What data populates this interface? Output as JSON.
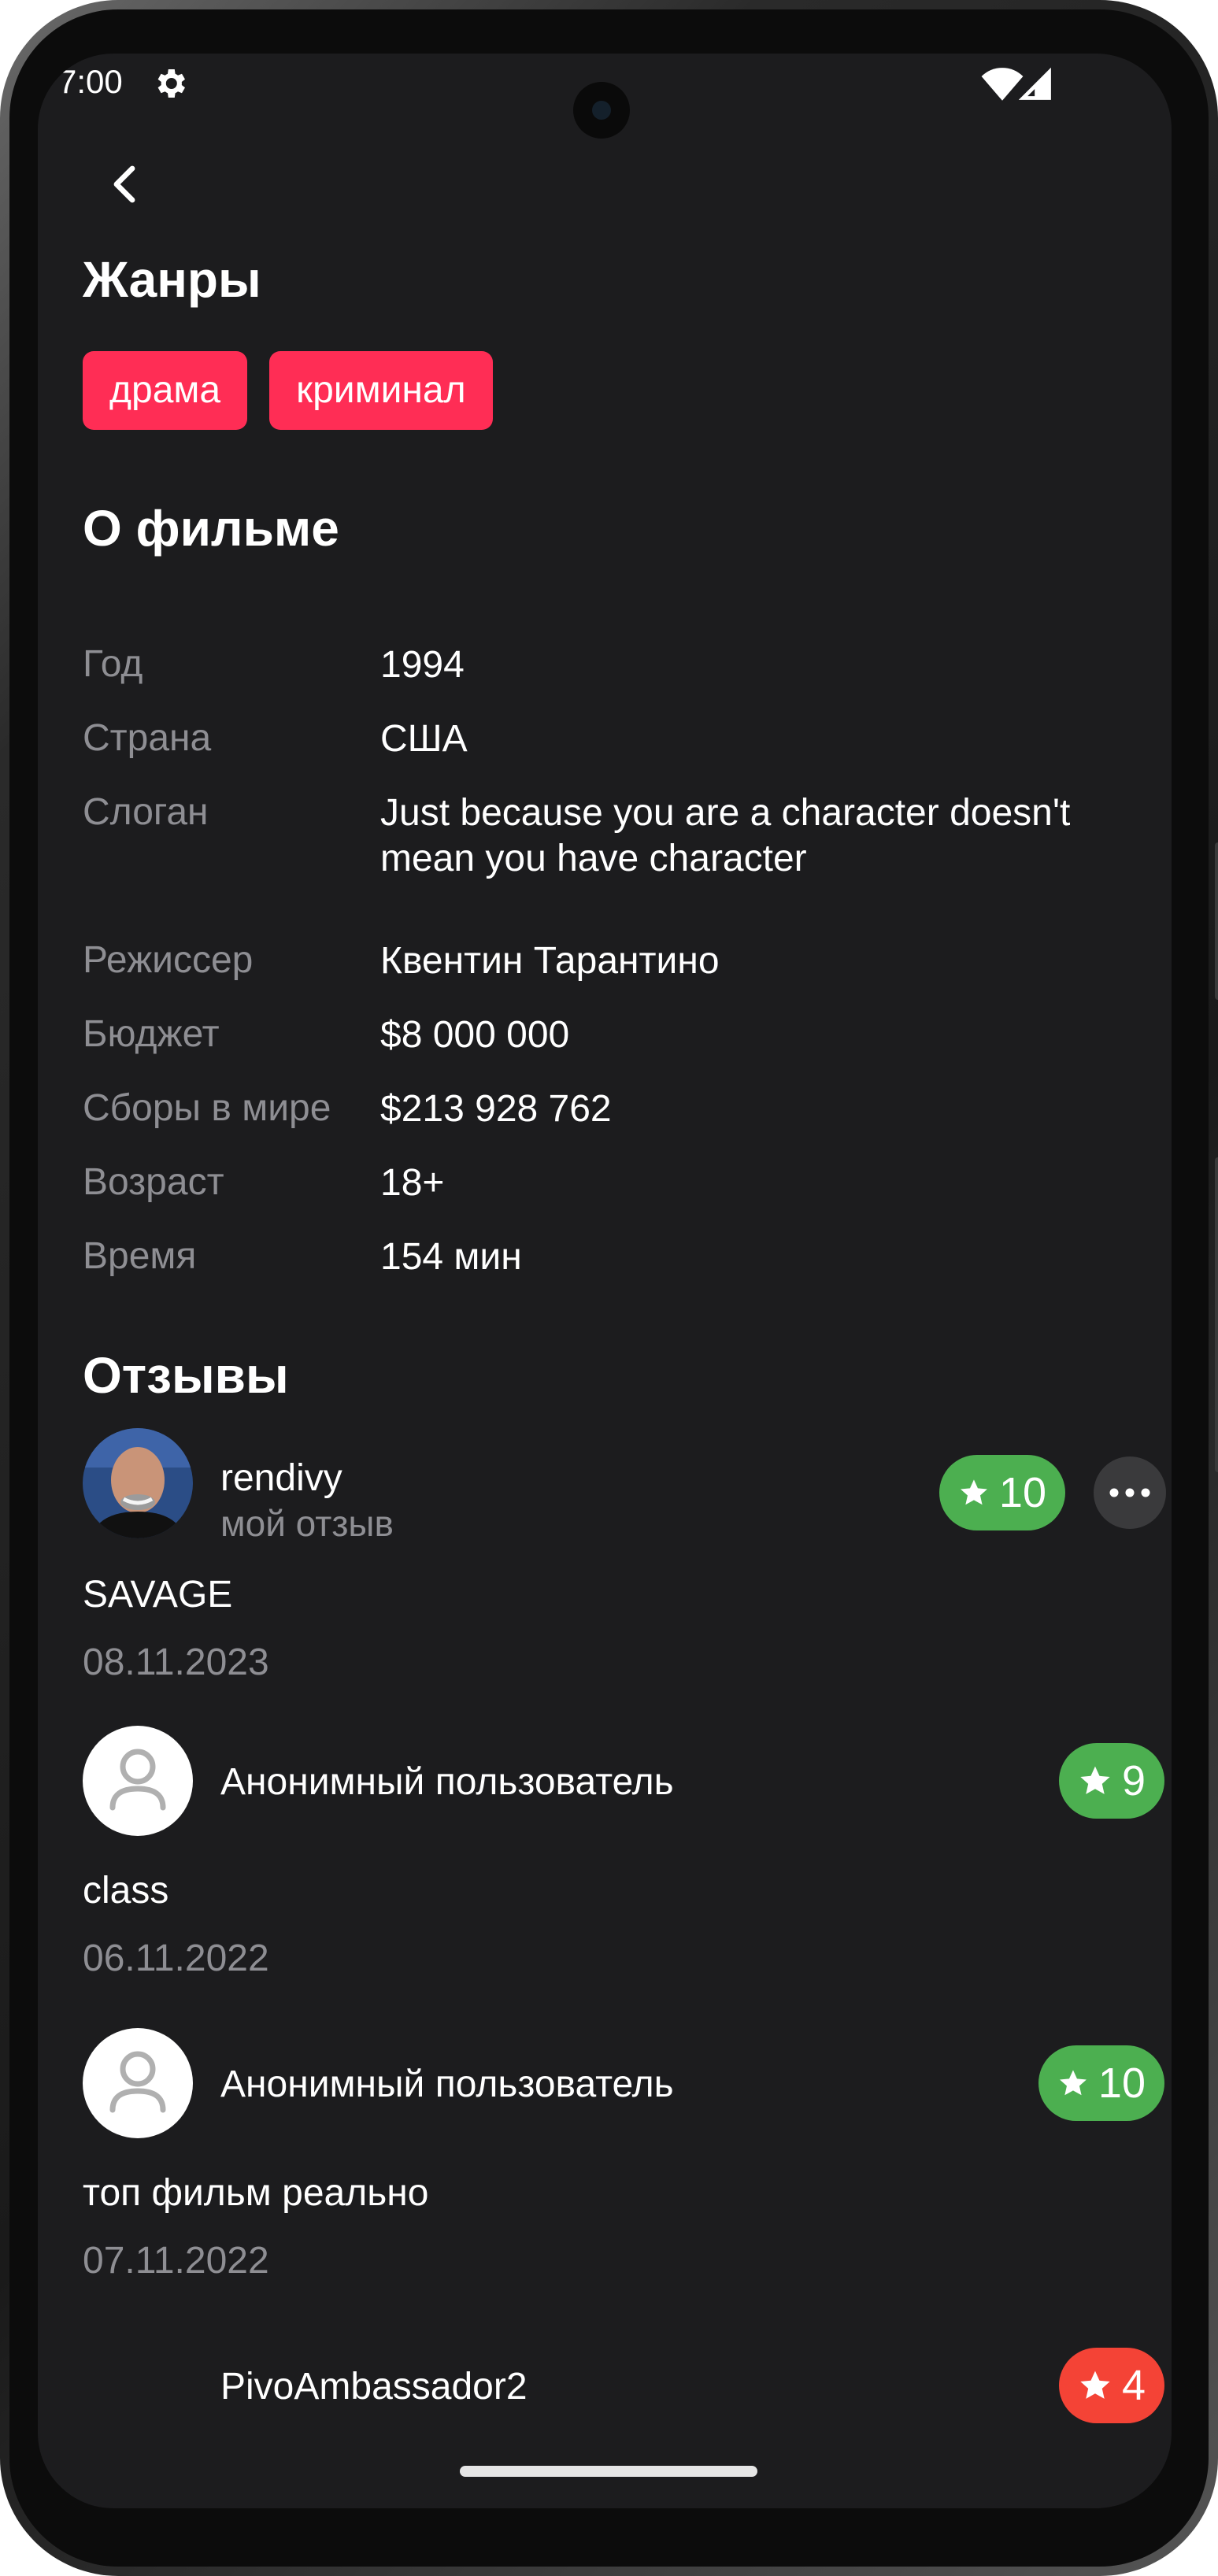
{
  "status_bar": {
    "time": "7:00"
  },
  "genres": {
    "title": "Жанры",
    "items": [
      "драма",
      "криминал"
    ],
    "chip_color": "#ff2d55"
  },
  "about": {
    "title": "О фильме",
    "rows": [
      {
        "label": "Год",
        "value": "1994"
      },
      {
        "label": "Страна",
        "value": "США"
      },
      {
        "label": "Слоган",
        "value": "Just because you are a character doesn't mean you have character"
      },
      {
        "label": "Режиссер",
        "value": "Квентин Тарантино"
      },
      {
        "label": "Бюджет",
        "value": "$8 000 000"
      },
      {
        "label": "Сборы в мире",
        "value": "$213 928 762"
      },
      {
        "label": "Возраст",
        "value": "18+"
      },
      {
        "label": "Время",
        "value": "154 мин"
      }
    ]
  },
  "reviews": {
    "title": "Отзывы",
    "items": [
      {
        "author": "rendivy",
        "subtitle": "мой отзыв",
        "text": "SAVAGE",
        "date": "08.11.2023",
        "rating": "10",
        "rating_color": "#4caf50",
        "avatar": "photo"
      },
      {
        "author": "Анонимный пользователь",
        "text": "class",
        "date": "06.11.2022",
        "rating": "9",
        "rating_color": "#4caf50",
        "avatar": "anonymous"
      },
      {
        "author": "Анонимный пользователь",
        "text": "топ фильм реально",
        "date": "07.11.2022",
        "rating": "10",
        "rating_color": "#4caf50",
        "avatar": "anonymous"
      },
      {
        "author": "PivoAmbassador2",
        "rating": "4",
        "rating_color": "#f44336"
      }
    ]
  },
  "icons": {
    "back": "chevron-left-icon",
    "settings": "gear-icon",
    "wifi": "wifi-icon",
    "signal": "signal-icon",
    "star": "star-icon",
    "more": "more-horizontal-icon",
    "user": "user-icon"
  }
}
